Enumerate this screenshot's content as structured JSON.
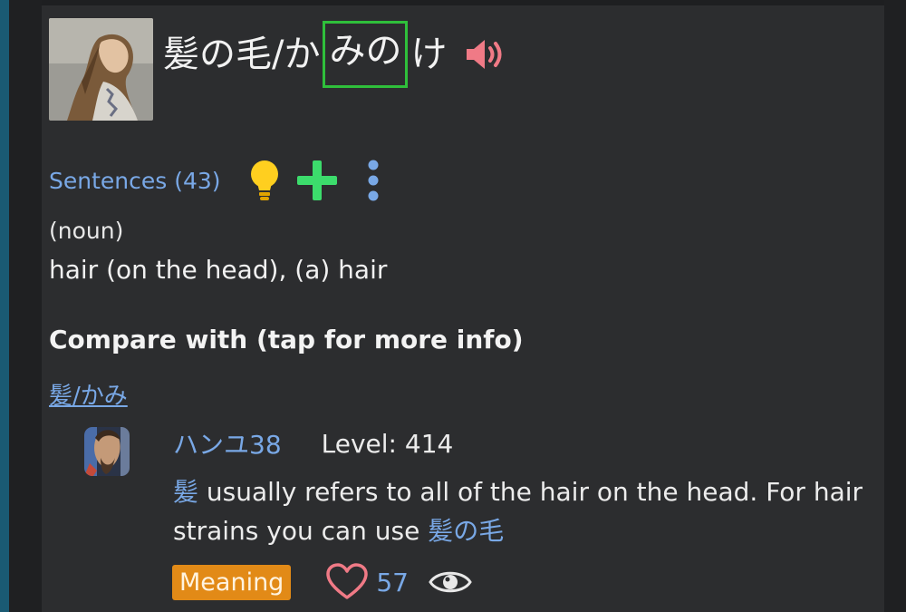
{
  "word": {
    "kanji": "髪の毛",
    "separator": "/",
    "kana_pre": "か",
    "kana_accent": "みの",
    "kana_post": "け",
    "audio_icon": "speaker-icon"
  },
  "sentences": {
    "label": "Sentences (43)",
    "icons": [
      "lightbulb-icon",
      "plus-icon",
      "more-vertical-icon"
    ]
  },
  "definition": {
    "part_of_speech": "(noun)",
    "meaning": "hair (on the head), (a) hair"
  },
  "compare": {
    "heading": "Compare with (tap for more info)",
    "link": "髪/かみ"
  },
  "comment": {
    "username": "ハンユ38",
    "level": "Level: 414",
    "text_kanji": "髪",
    "text_body": " usually refers to all of the hair on the head. For hair strains you can use ",
    "text_link": "髪の毛",
    "tag": "Meaning",
    "likes": "57",
    "icons": [
      "heart-icon",
      "eye-icon"
    ]
  },
  "colors": {
    "link": "#79a8e6",
    "accent_box": "#2fbf3b",
    "tag": "#e28a17",
    "heart": "#f07a86",
    "plus": "#3cdc6c",
    "speaker": "#f07a86"
  }
}
